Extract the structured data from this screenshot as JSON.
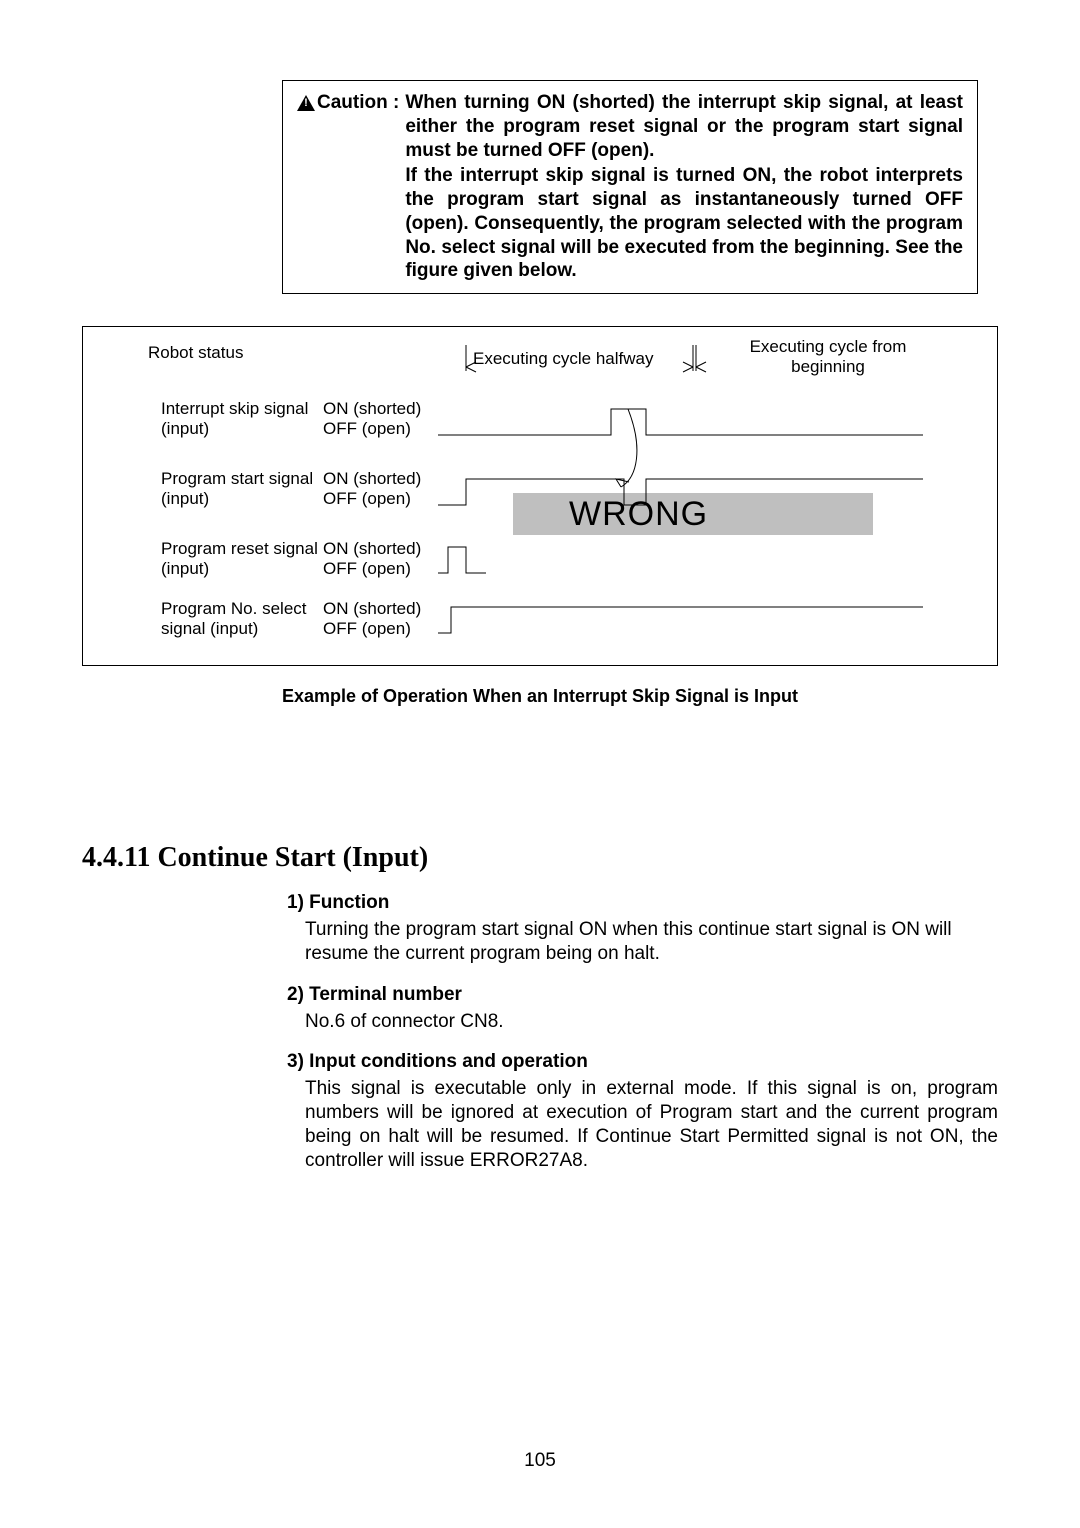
{
  "caution": {
    "label": "Caution :",
    "p1": "When turning ON (shorted) the interrupt skip signal, at least either the program reset signal or the program start signal must be turned OFF (open).",
    "p2": "If the interrupt skip signal is turned ON, the robot interprets the program start signal as instantaneously turned OFF (open). Consequently, the program selected with the program No. select signal will be executed from the beginning. See the figure given below."
  },
  "diagram": {
    "robot_status": "Robot status",
    "executing_halfway": "Executing cycle halfway",
    "executing_beginning": "Executing cycle from beginning",
    "rows": [
      {
        "name": "Interrupt skip signal (input)",
        "on": "ON (shorted)",
        "off": "OFF (open)"
      },
      {
        "name": "Program start signal (input)",
        "on": "ON (shorted)",
        "off": "OFF (open)"
      },
      {
        "name": "Program reset signal (input)",
        "on": "ON (shorted)",
        "off": "OFF (open)"
      },
      {
        "name": "Program No. select signal (input)",
        "on": "ON (shorted)",
        "off": "OFF (open)"
      }
    ],
    "wrong": "WRONG",
    "caption": "Example of Operation When an Interrupt Skip Signal is Input"
  },
  "section": {
    "number_title": "4.4.11 Continue Start (Input)",
    "s1h": "1) Function",
    "s1b": "Turning the program start signal ON when this continue start signal is ON will resume the current program being on halt.",
    "s2h": "2) Terminal number",
    "s2b": "No.6 of connector CN8.",
    "s3h": "3) Input conditions and operation",
    "s3b": "This signal is executable only in external mode.  If this signal is on, program numbers will be ignored at execution of Program start and the current program being on halt will be resumed.  If Continue Start Permitted signal is not ON, the controller will issue ERROR27A8."
  },
  "page_number": "105"
}
